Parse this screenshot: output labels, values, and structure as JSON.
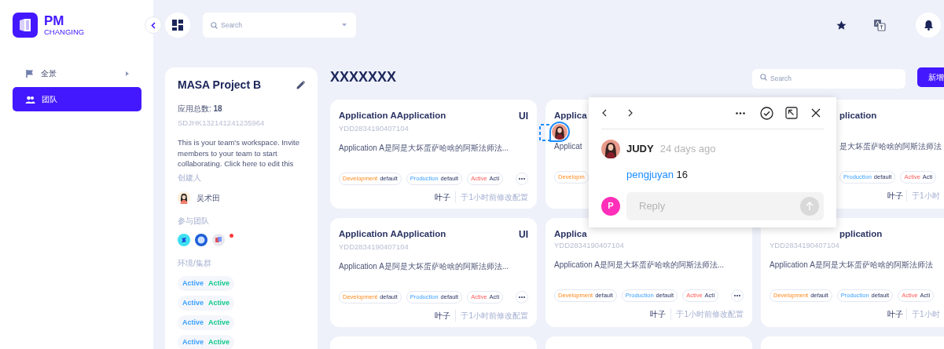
{
  "logo": {
    "title": "PM",
    "subtitle": "CHANGING"
  },
  "sidebar": {
    "items": [
      {
        "label": "全景",
        "selected": false,
        "has_submenu": true
      },
      {
        "label": "团队",
        "selected": true,
        "has_submenu": false
      }
    ]
  },
  "top_search": {
    "placeholder": "Search"
  },
  "project": {
    "title": "MASA Project B",
    "app_count_label": "应用总数: ",
    "app_count": "18",
    "code": "SDJHK132141241235964",
    "description": "This is your team's workspace. Invite members to your team to start collaborating. Click here to edit this",
    "creator_label": "创建人",
    "creator": "吴术田",
    "teams_label": "参与团队",
    "teams_alert": true,
    "clusters_label": "环境/集群",
    "clusters": [
      {
        "env": "Active",
        "cluster": "Active"
      },
      {
        "env": "Active",
        "cluster": "Active"
      },
      {
        "env": "Active",
        "cluster": "Active"
      },
      {
        "env": "Active",
        "cluster": "Active"
      }
    ]
  },
  "content": {
    "title": "XXXXXXX",
    "search_placeholder": "Search",
    "add_button": "新增"
  },
  "cards": [
    {
      "kind": "full",
      "title": "Application AApplication",
      "type": "UI",
      "code": "YDD2834190407104",
      "description": "Application A是阿是大坏蛋萨哈啥的阿斯法师法...",
      "tags": [
        {
          "kind": "development",
          "label": "Development",
          "value": "default"
        },
        {
          "kind": "production",
          "label": "Production",
          "value": "default"
        },
        {
          "kind": "active",
          "label": "Active",
          "value": "Acti"
        }
      ],
      "more": true,
      "user": "叶子",
      "time": "于1小时前修改配置"
    },
    {
      "kind": "covered",
      "title": "Applica",
      "description": "Applicat",
      "tags": [
        {
          "kind": "development",
          "label": "Developm"
        }
      ]
    },
    {
      "kind": "peek",
      "title": "plication",
      "description": "是大坏蛋萨哈啥的阿斯法师法",
      "tags": [
        {
          "kind": "production",
          "label": "Production",
          "value": "default"
        },
        {
          "kind": "active",
          "label": "Active",
          "value": "Acti"
        }
      ],
      "user": "叶子",
      "time": "于1小时"
    },
    {
      "kind": "full",
      "title": "Application AApplication",
      "type": "UI",
      "code": "YDD2834190407104",
      "description": "Application A是阿是大坏蛋萨哈啥的阿斯法师法...",
      "tags": [
        {
          "kind": "development",
          "label": "Development",
          "value": "default"
        },
        {
          "kind": "production",
          "label": "Production",
          "value": "default"
        },
        {
          "kind": "active",
          "label": "Active",
          "value": "Acti"
        }
      ],
      "more": true,
      "user": "叶子",
      "time": "于1小时前修改配置"
    },
    {
      "kind": "full",
      "title": "Applica",
      "code": "YDD2834190407104",
      "description": "Application A是阿是大坏蛋萨哈啥的阿斯法师法...",
      "tags": [
        {
          "kind": "development",
          "label": "Development",
          "value": "default"
        },
        {
          "kind": "production",
          "label": "Production",
          "value": "default"
        },
        {
          "kind": "active",
          "label": "Active",
          "value": "Acti"
        }
      ],
      "more": true,
      "user": "叶子",
      "time": "于1小时前修改配置"
    },
    {
      "kind": "peek-title",
      "title": "pplication",
      "code": "YDD2834190407104",
      "description": "Application A是阿是大坏蛋萨哈啥的阿斯法师法",
      "tags": [
        {
          "kind": "development",
          "label": "Development",
          "value": "default"
        },
        {
          "kind": "production",
          "label": "Production",
          "value": "default"
        },
        {
          "kind": "active",
          "label": "Active",
          "value": "Acti"
        }
      ],
      "user": "叶子",
      "time": "于1小时"
    },
    {
      "kind": "stub"
    },
    {
      "kind": "stub"
    },
    {
      "kind": "stub"
    }
  ],
  "comment": {
    "author": "JUDY",
    "time": "24 days ago",
    "mention": "pengjuyan",
    "text": "16",
    "reply_avatar": "P",
    "reply_placeholder": "Reply"
  }
}
